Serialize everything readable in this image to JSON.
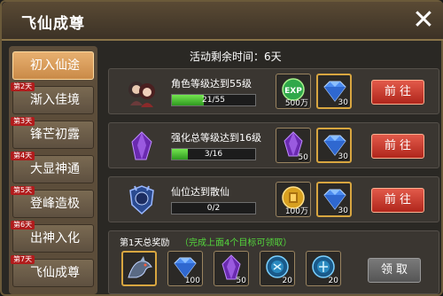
{
  "window": {
    "title": "飞仙成尊",
    "close_icon": "close-icon"
  },
  "sidebar": {
    "items": [
      {
        "label": "初入仙途",
        "day": "",
        "active": true
      },
      {
        "label": "渐入佳境",
        "day": "第2天",
        "active": false
      },
      {
        "label": "锋芒初露",
        "day": "第3天",
        "active": false
      },
      {
        "label": "大显神通",
        "day": "第4天",
        "active": false
      },
      {
        "label": "登峰造极",
        "day": "第5天",
        "active": false
      },
      {
        "label": "出神入化",
        "day": "第6天",
        "active": false
      },
      {
        "label": "飞仙成尊",
        "day": "第7天",
        "active": false
      }
    ]
  },
  "activity": {
    "remaining": "活动剩余时间：6天"
  },
  "tasks": [
    {
      "description": "角色等级达到55级",
      "progress_text": "21/55",
      "progress": 0.382,
      "icon": "characters-portrait-icon",
      "rewards": [
        {
          "icon": "exp-orb-icon",
          "count": "500万"
        },
        {
          "icon": "blue-diamond-icon",
          "count": "30"
        }
      ],
      "button_label": "前 往"
    },
    {
      "description": "强化总等级达到16级",
      "progress_text": "3/16",
      "progress": 0.1875,
      "icon": "purple-crystal-icon",
      "rewards": [
        {
          "icon": "purple-crystal-icon",
          "count": "50"
        },
        {
          "icon": "blue-diamond-icon",
          "count": "30"
        }
      ],
      "button_label": "前 往"
    },
    {
      "description": "仙位达到散仙",
      "progress_text": "0/2",
      "progress": 0,
      "icon": "immortal-rank-badge-icon",
      "rewards": [
        {
          "icon": "gold-coin-icon",
          "count": "100万"
        },
        {
          "icon": "blue-diamond-icon",
          "count": "30"
        }
      ],
      "button_label": "前 往"
    }
  ],
  "total_reward": {
    "title": "第1天总奖励",
    "note": "（完成上面4个目标可领取）",
    "items": [
      {
        "icon": "mount-creature-icon",
        "count": ""
      },
      {
        "icon": "blue-diamond-icon",
        "count": "100"
      },
      {
        "icon": "purple-crystal-icon",
        "count": "50"
      },
      {
        "icon": "blue-rune-orb-icon",
        "count": "20"
      },
      {
        "icon": "blue-rune-orb-icon",
        "count": "20"
      }
    ],
    "claim_label": "领 取"
  },
  "colors": {
    "accent_red": "#c8362a",
    "progress_green": "#4cc83a",
    "note_green": "#54d83c",
    "active_tab": "#d99a58"
  }
}
